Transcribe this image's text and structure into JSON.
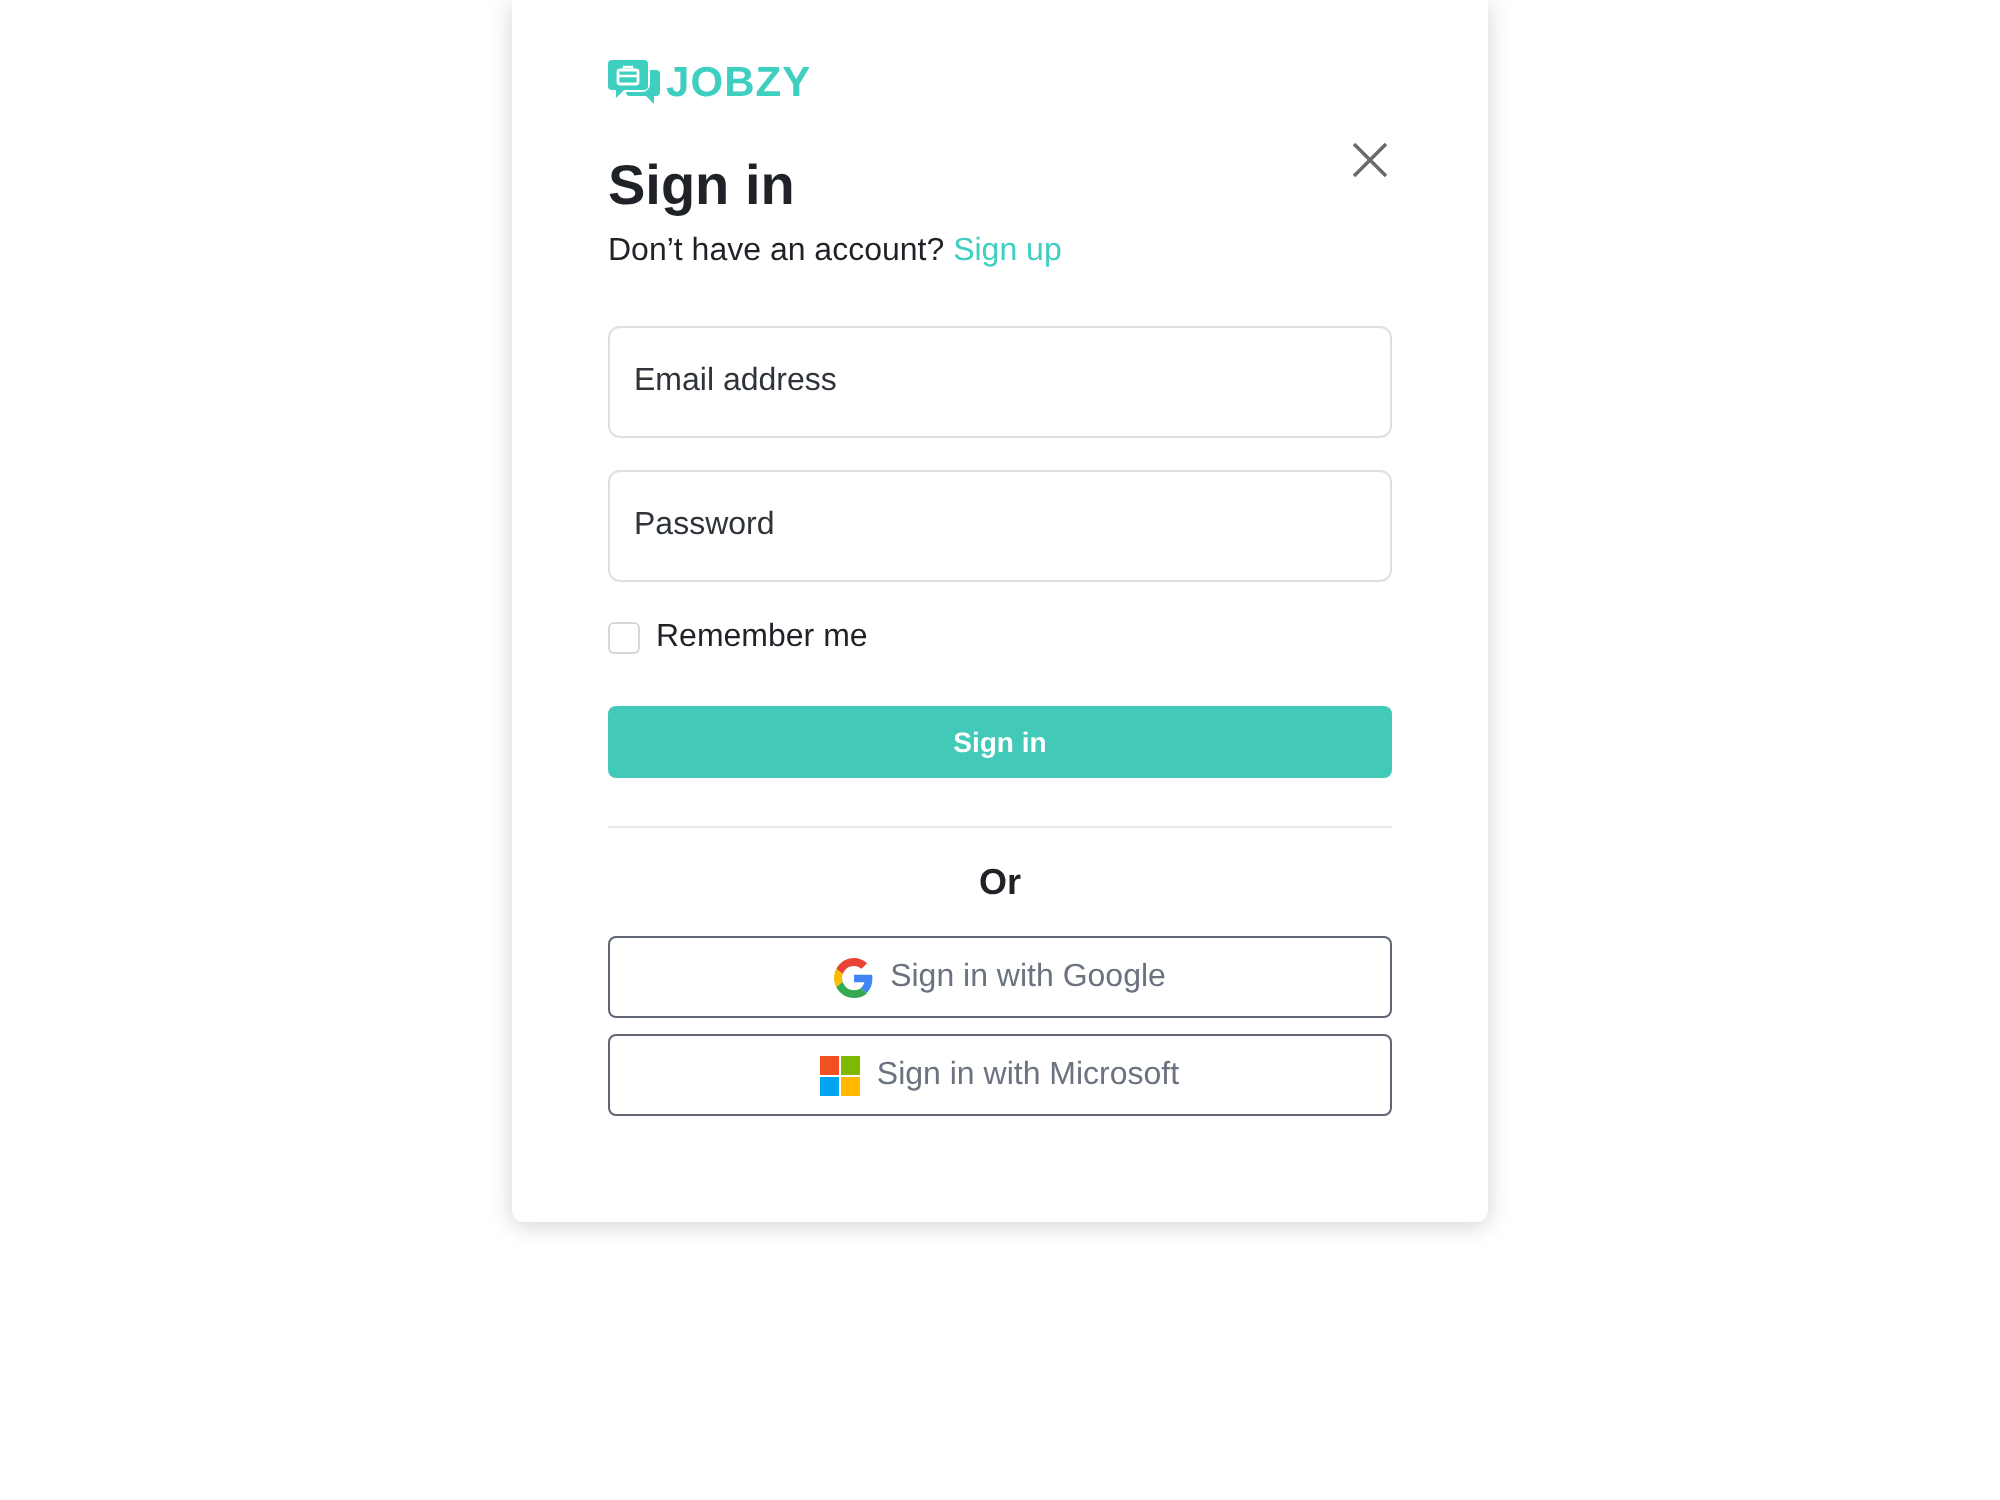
{
  "logo": {
    "text": "JOBZY"
  },
  "heading": "Sign in",
  "prompt": {
    "text": "Don’t have an account?",
    "link": "Sign up"
  },
  "fields": [
    {
      "placeholder": "Email address"
    },
    {
      "placeholder": "Password"
    }
  ],
  "remember_me": {
    "label": "Remember me",
    "checked": false
  },
  "submit_button": "Sign in",
  "divider_label": "Or",
  "social_buttons": [
    {
      "kind": "google",
      "label": "Sign in with Google"
    },
    {
      "kind": "microsoft",
      "label": "Sign in with Microsoft"
    }
  ]
}
